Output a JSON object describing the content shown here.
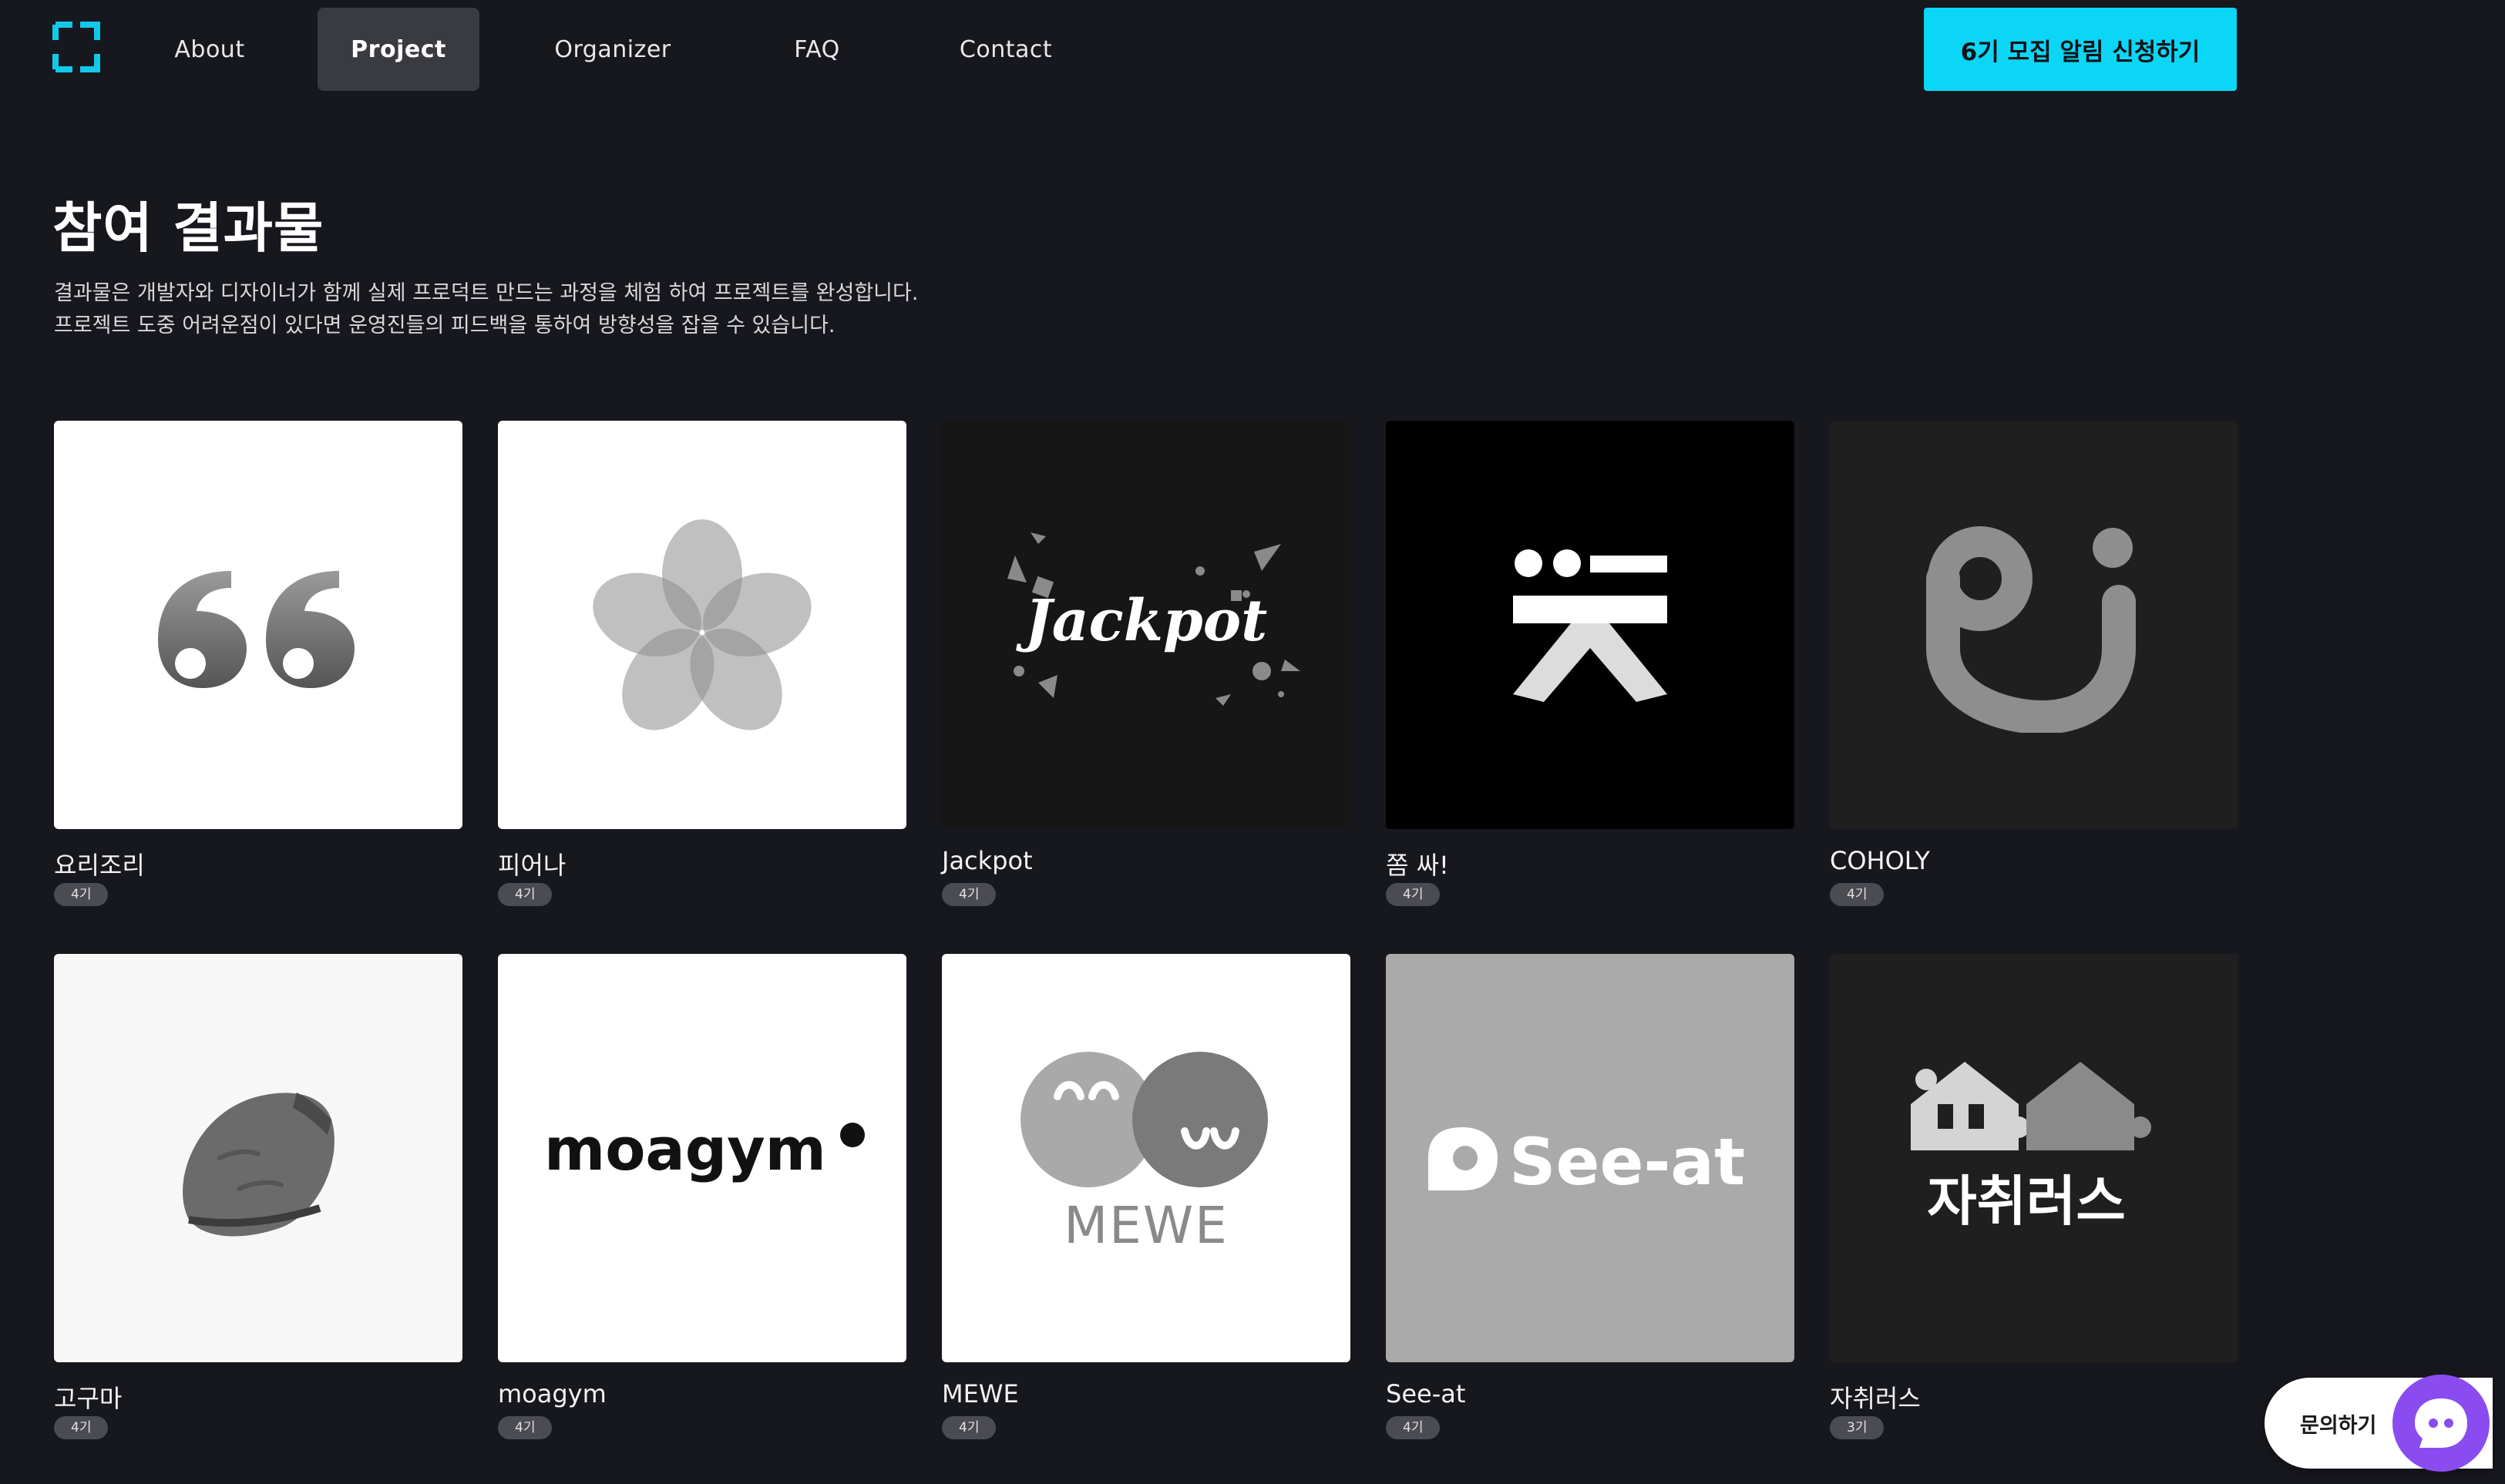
{
  "header": {
    "nav": [
      {
        "label": "About"
      },
      {
        "label": "Project"
      },
      {
        "label": "Organizer"
      },
      {
        "label": "FAQ"
      },
      {
        "label": "Contact"
      }
    ],
    "cta_label": "6기 모집 알림 신청하기"
  },
  "intro": {
    "title": "참여 결과물",
    "description_lines": [
      "결과물은 개발자와 디자이너가 함께 실제 프로덕트 만드는 과정을 체험 하여 프로젝트를 완성합니다.",
      "프로젝트 도중 어려운점이 있다면 운영진들의 피드백을 통하여 방향성을 잡을 수 있습니다."
    ]
  },
  "projects": [
    {
      "title": "요리조리",
      "badge": "4기",
      "logo": "quote-eyes-icon",
      "bg": "#ffffff"
    },
    {
      "title": "피어나",
      "badge": "4기",
      "logo": "flower-icon",
      "bg": "#ffffff"
    },
    {
      "title": "Jackpot",
      "badge": "4기",
      "logo": "jackpot-wordmark",
      "logo_text": "Jackpot",
      "bg": "#161616"
    },
    {
      "title": "쫌 싸!",
      "badge": "4기",
      "logo": "jjom-ssa-icon",
      "bg": "#000000"
    },
    {
      "title": "COHOLY",
      "badge": "4기",
      "logo": "coholy-icon",
      "bg": "#1f1f1f"
    },
    {
      "title": "고구마",
      "badge": "4기",
      "logo": "sweet-potato-icon",
      "bg": "#f7f7f7"
    },
    {
      "title": "moagym",
      "badge": "4기",
      "logo": "moagym-wordmark",
      "logo_text": "moagym",
      "bg": "#ffffff"
    },
    {
      "title": "MEWE",
      "badge": "4기",
      "logo": "mewe-icon",
      "logo_text": "MEWE",
      "bg": "#ffffff"
    },
    {
      "title": "See-at",
      "badge": "4기",
      "logo": "see-at-wordmark",
      "logo_text": "See-at",
      "bg": "#aaaaaa"
    },
    {
      "title": "자취러스",
      "badge": "3기",
      "logo": "jachwi-houses-icon",
      "logo_text": "자취러스",
      "bg": "#1f1f1f"
    }
  ],
  "help": {
    "label": "문의하기",
    "icon": "chat-bubble-icon"
  },
  "colors": {
    "accent": "#0cd6f5",
    "background": "#17181e",
    "help_button": "#8a4cf0"
  }
}
